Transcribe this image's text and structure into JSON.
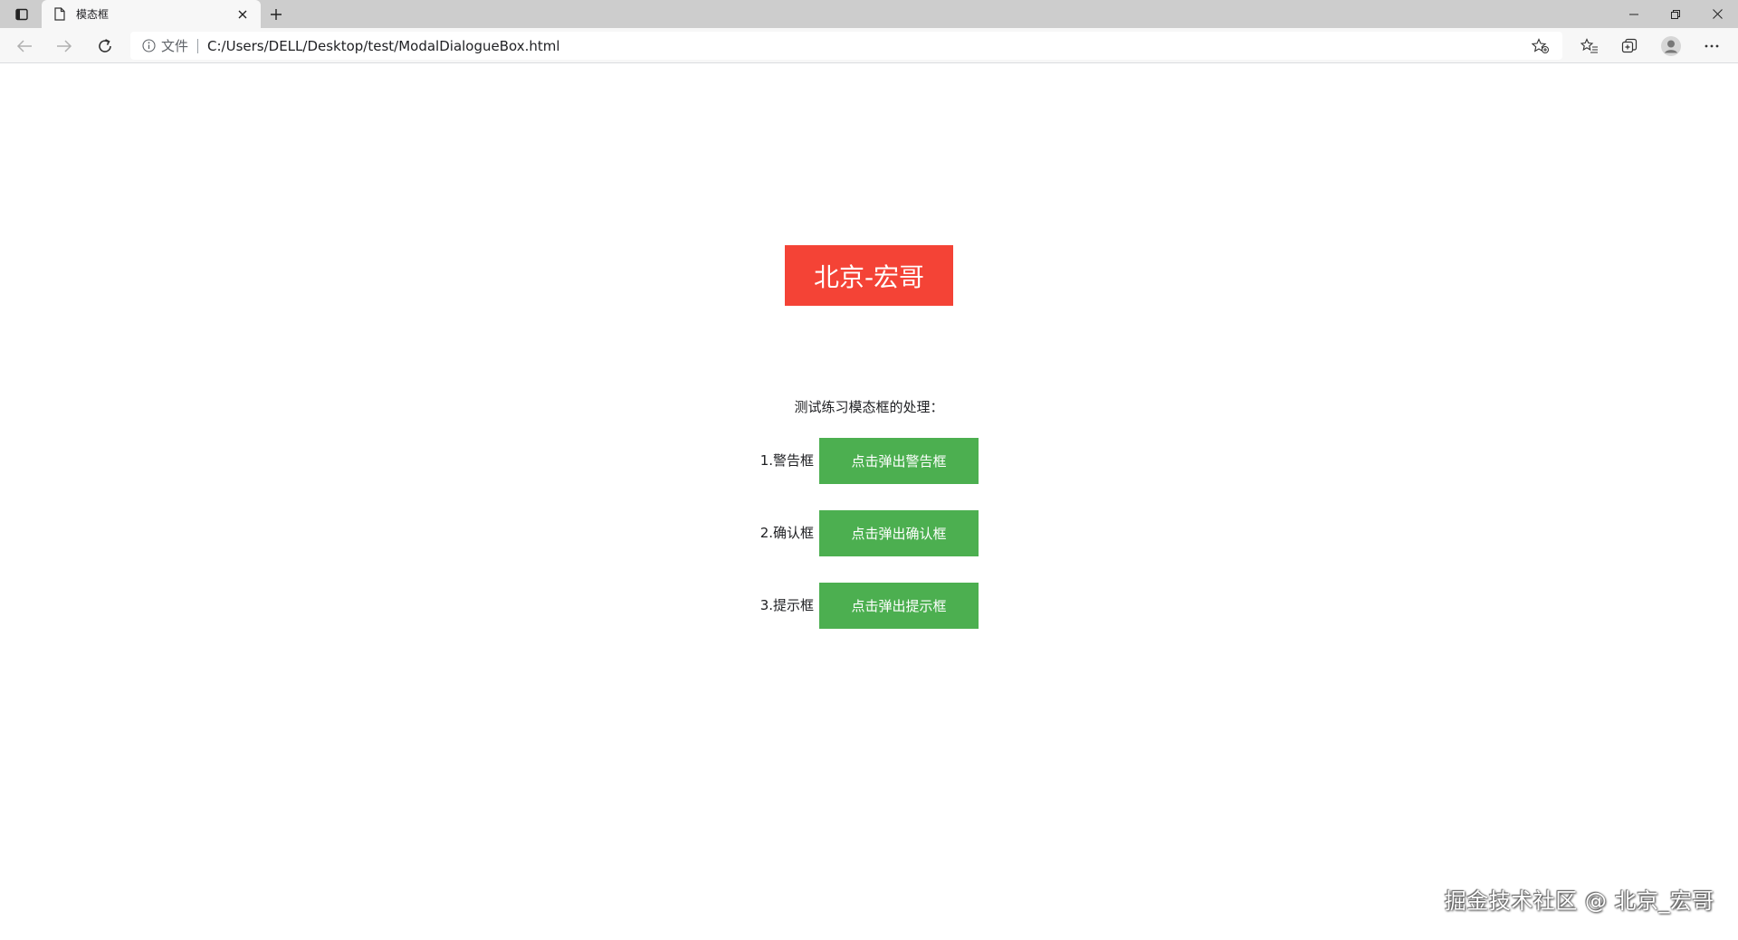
{
  "browser": {
    "tab": {
      "title": "模态框",
      "favicon_icon": "page-icon"
    },
    "address_bar": {
      "scheme_label": "文件",
      "url": "C:/Users/DELL/Desktop/test/ModalDialogueBox.html"
    },
    "window_controls": {
      "minimize": "–",
      "restore": "❐",
      "close": "✕"
    }
  },
  "page": {
    "brand_label": "北京-宏哥",
    "intro_text": "测试练习模态框的处理：",
    "rows": [
      {
        "label": "1.警告框",
        "button": "点击弹出警告框"
      },
      {
        "label": "2.确认框",
        "button": "点击弹出确认框"
      },
      {
        "label": "3.提示框",
        "button": "点击弹出提示框"
      }
    ]
  },
  "watermark": "掘金技术社区 @ 北京_宏哥",
  "colors": {
    "brand_red": "#f44336",
    "button_green": "#4caf50"
  }
}
